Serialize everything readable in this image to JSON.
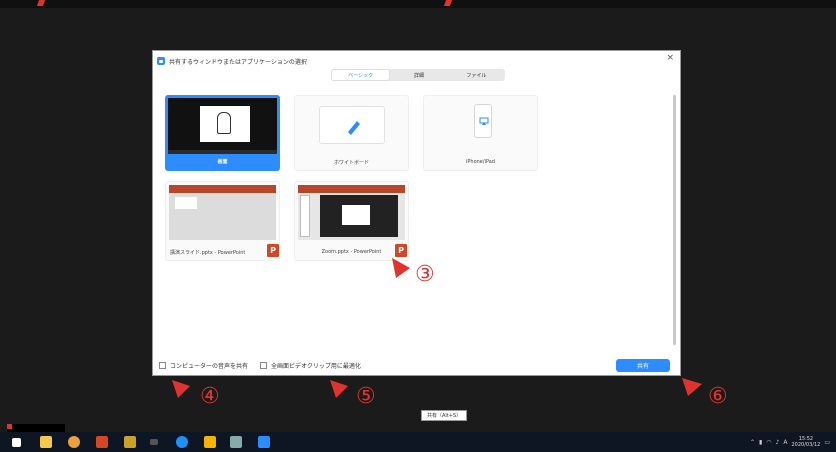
{
  "dialog": {
    "title": "共有するウィンドウまたはアプリケーションの選択",
    "close": "×",
    "tabs": [
      {
        "label": "ベーシック",
        "active": true
      },
      {
        "label": "詳細",
        "active": false
      },
      {
        "label": "ファイル",
        "active": false
      }
    ],
    "tiles": [
      {
        "label": "画面",
        "selected": true
      },
      {
        "label": "ホワイトボード",
        "selected": false
      },
      {
        "label": "iPhone/iPad",
        "selected": false
      },
      {
        "label": "講演スライド.pptx - PowerPoint",
        "selected": false
      },
      {
        "label": "Zoom.pptx - PowerPoint",
        "selected": false
      }
    ],
    "ppt_badge": "P",
    "options": {
      "share_audio": "コンピューターの音声を共有",
      "optimize_video": "全画面ビデオクリップ用に最適化"
    },
    "share_button": "共有"
  },
  "annotations": {
    "m3": "③",
    "m4": "④",
    "m5": "⑤",
    "m6": "⑥",
    "color": "#e0332f"
  },
  "tooltip": "共有（Alt+S）",
  "taskbar": {
    "clock_time": "15:52",
    "clock_date": "2020/03/12",
    "ime": "A",
    "icons": [
      "windows-start-icon",
      "file-explorer-icon",
      "chrome-icon",
      "powerpoint-icon",
      "sticky-icon",
      "app-icon",
      "edge-icon",
      "sticky-notes-icon",
      "tool-icon",
      "zoom-icon"
    ]
  },
  "colors": {
    "accent": "#2d8cff",
    "ppt": "#d24726",
    "background": "#1b1b1b",
    "taskbar": "#0f1623"
  }
}
